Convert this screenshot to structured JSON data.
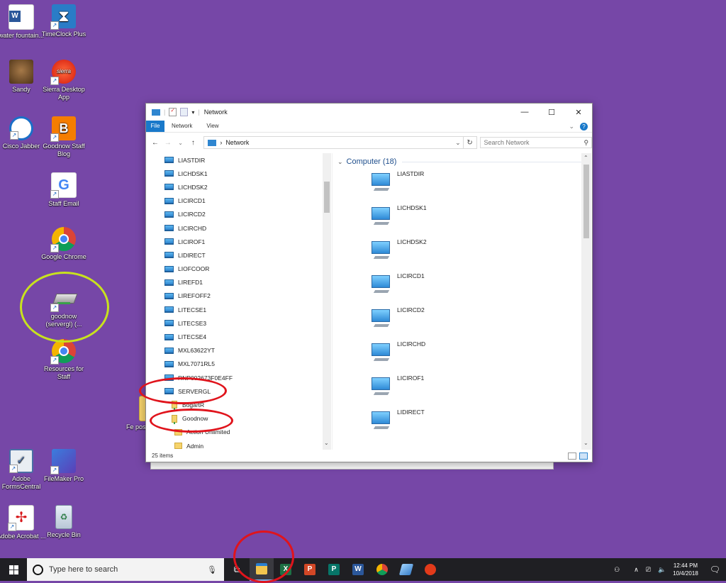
{
  "desktop": {
    "icons": [
      {
        "label": "water fountain...",
        "kind": "word"
      },
      {
        "label": "TimeClock Plus",
        "kind": "hourglass"
      },
      {
        "label": "Sandy",
        "kind": "photo"
      },
      {
        "label": "Sierra Desktop App",
        "kind": "sierra"
      },
      {
        "label": "Cisco Jabber",
        "kind": "jabber"
      },
      {
        "label": "Goodnow Staff Blog",
        "kind": "blogger"
      },
      {
        "label": "Staff Email",
        "kind": "google"
      },
      {
        "label": "Google Chrome",
        "kind": "chrome"
      },
      {
        "label": "goodnow (servergl) (...",
        "kind": "drive"
      },
      {
        "label": "Resources for Staff",
        "kind": "chrome"
      },
      {
        "label": "Adobe FormsCentral",
        "kind": "forms"
      },
      {
        "label": "FileMaker Pro",
        "kind": "filemaker"
      },
      {
        "label": "Adobe Acrobat ...",
        "kind": "acrobat"
      },
      {
        "label": "Recycle Bin",
        "kind": "recycle"
      },
      {
        "label": "Fe post",
        "kind": "folder"
      }
    ]
  },
  "explorer": {
    "title": "Network",
    "ribbon_tabs": [
      "File",
      "Network",
      "View"
    ],
    "address": "Network",
    "search_placeholder": "Search Network",
    "nav_items": [
      {
        "label": "LIASTDIR",
        "type": "pc"
      },
      {
        "label": "LICHDSK1",
        "type": "pc"
      },
      {
        "label": "LICHDSK2",
        "type": "pc"
      },
      {
        "label": "LICIRCD1",
        "type": "pc"
      },
      {
        "label": "LICIRCD2",
        "type": "pc"
      },
      {
        "label": "LICIRCHD",
        "type": "pc"
      },
      {
        "label": "LICIROF1",
        "type": "pc"
      },
      {
        "label": "LIDIRECT",
        "type": "pc"
      },
      {
        "label": "LIOFCOOR",
        "type": "pc"
      },
      {
        "label": "LIREFD1",
        "type": "pc"
      },
      {
        "label": "LIREFOFF2",
        "type": "pc"
      },
      {
        "label": "LITECSE1",
        "type": "pc"
      },
      {
        "label": "LITECSE3",
        "type": "pc"
      },
      {
        "label": "LITECSE4",
        "type": "pc"
      },
      {
        "label": "MXL63622YT",
        "type": "pc"
      },
      {
        "label": "MXL7071RL5",
        "type": "pc"
      },
      {
        "label": "RNP002673F0E4FF",
        "type": "pc"
      },
      {
        "label": "SERVERGL",
        "type": "pc"
      },
      {
        "label": "BogartR",
        "type": "share"
      },
      {
        "label": "Goodnow",
        "type": "share"
      },
      {
        "label": "Action Unlimited",
        "type": "folder"
      },
      {
        "label": "Admin",
        "type": "folder"
      }
    ],
    "group_header": "Computer (18)",
    "content_items": [
      "LIASTDIR",
      "LICHDSK1",
      "LICHDSK2",
      "LICIRCD1",
      "LICIRCD2",
      "LICIRCHD",
      "LICIROF1",
      "LIDIRECT"
    ],
    "status": "25 items"
  },
  "taskbar": {
    "search_placeholder": "Type here to search",
    "time": "12:44 PM",
    "date": "10/4/2018"
  },
  "colors": {
    "desktop": "#7647a7",
    "annotation_red": "#e0141c",
    "annotation_green": "#c8e21e"
  }
}
